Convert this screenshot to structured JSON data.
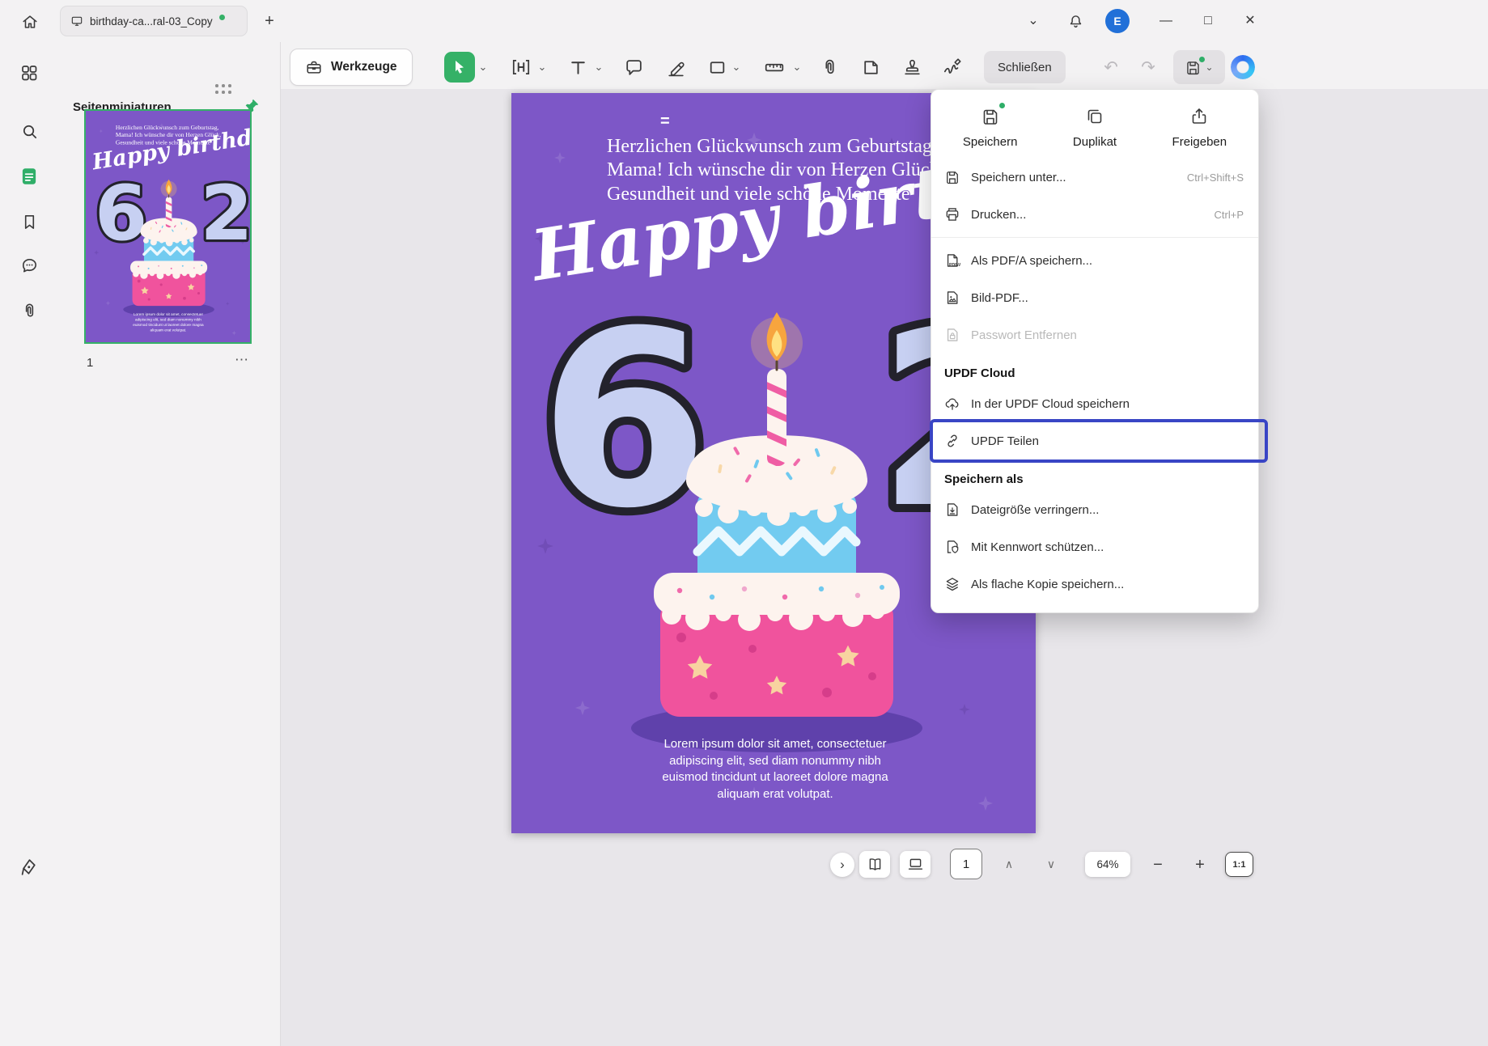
{
  "icons": {
    "chevron_down": "⌄",
    "nav_up": "∧",
    "nav_down": "∨",
    "chevron_right": "›",
    "plus": "+",
    "more": "⋯",
    "undo": "↶",
    "redo": "↷",
    "minimize": "—",
    "maximize": "□",
    "close": "✕",
    "equals_handle": "=",
    "minus": "−",
    "pdfa_label": "PDF/A"
  },
  "colors": {
    "accent_green": "#35b167",
    "highlight_blue": "#3945c5",
    "card_purple": "#7d57c7",
    "avatar_blue": "#2170d8"
  },
  "titlebar": {
    "tab_title": "birthday-ca...ral-03_Copy",
    "avatar_initial": "E"
  },
  "sidebar": {
    "panel_title": "Seitenminiaturen",
    "page_number": "1"
  },
  "toolbar": {
    "tools_label": "Werkzeuge",
    "close_label": "Schließen"
  },
  "menu": {
    "top_actions": [
      {
        "label": "Speichern"
      },
      {
        "label": "Duplikat"
      },
      {
        "label": "Freigeben"
      }
    ],
    "items": [
      {
        "label": "Speichern unter...",
        "shortcut": "Ctrl+Shift+S"
      },
      {
        "label": "Drucken...",
        "shortcut": "Ctrl+P"
      },
      {
        "label": "Als PDF/A speichern...",
        "shortcut": ""
      },
      {
        "label": "Bild-PDF...",
        "shortcut": ""
      },
      {
        "label": "Passwort Entfernen",
        "shortcut": ""
      }
    ],
    "cloud_header": "UPDF Cloud",
    "cloud_items": [
      {
        "label": "In der UPDF Cloud speichern"
      },
      {
        "label": "UPDF Teilen"
      }
    ],
    "saveas_header": "Speichern als",
    "saveas_items": [
      {
        "label": "Dateigröße verringern..."
      },
      {
        "label": "Mit Kennwort schützen..."
      },
      {
        "label": "Als flache Kopie speichern..."
      }
    ]
  },
  "document": {
    "greeting": "Herzlichen Glückwunsch zum Geburtstag, Mama! Ich wünsche dir von Herzen Glück, Gesundheit und viele schöne Momente",
    "script_text": "Happy birthday",
    "number_left": "6",
    "number_right": "2",
    "body_text": "Lorem ipsum dolor sit amet, consectetuer adipiscing elit, sed diam nonummy nibh euismod tincidunt ut laoreet dolore magna aliquam erat volutpat."
  },
  "statusbar": {
    "page_input": "1",
    "zoom_level": "64%",
    "fit_label": "1:1"
  }
}
